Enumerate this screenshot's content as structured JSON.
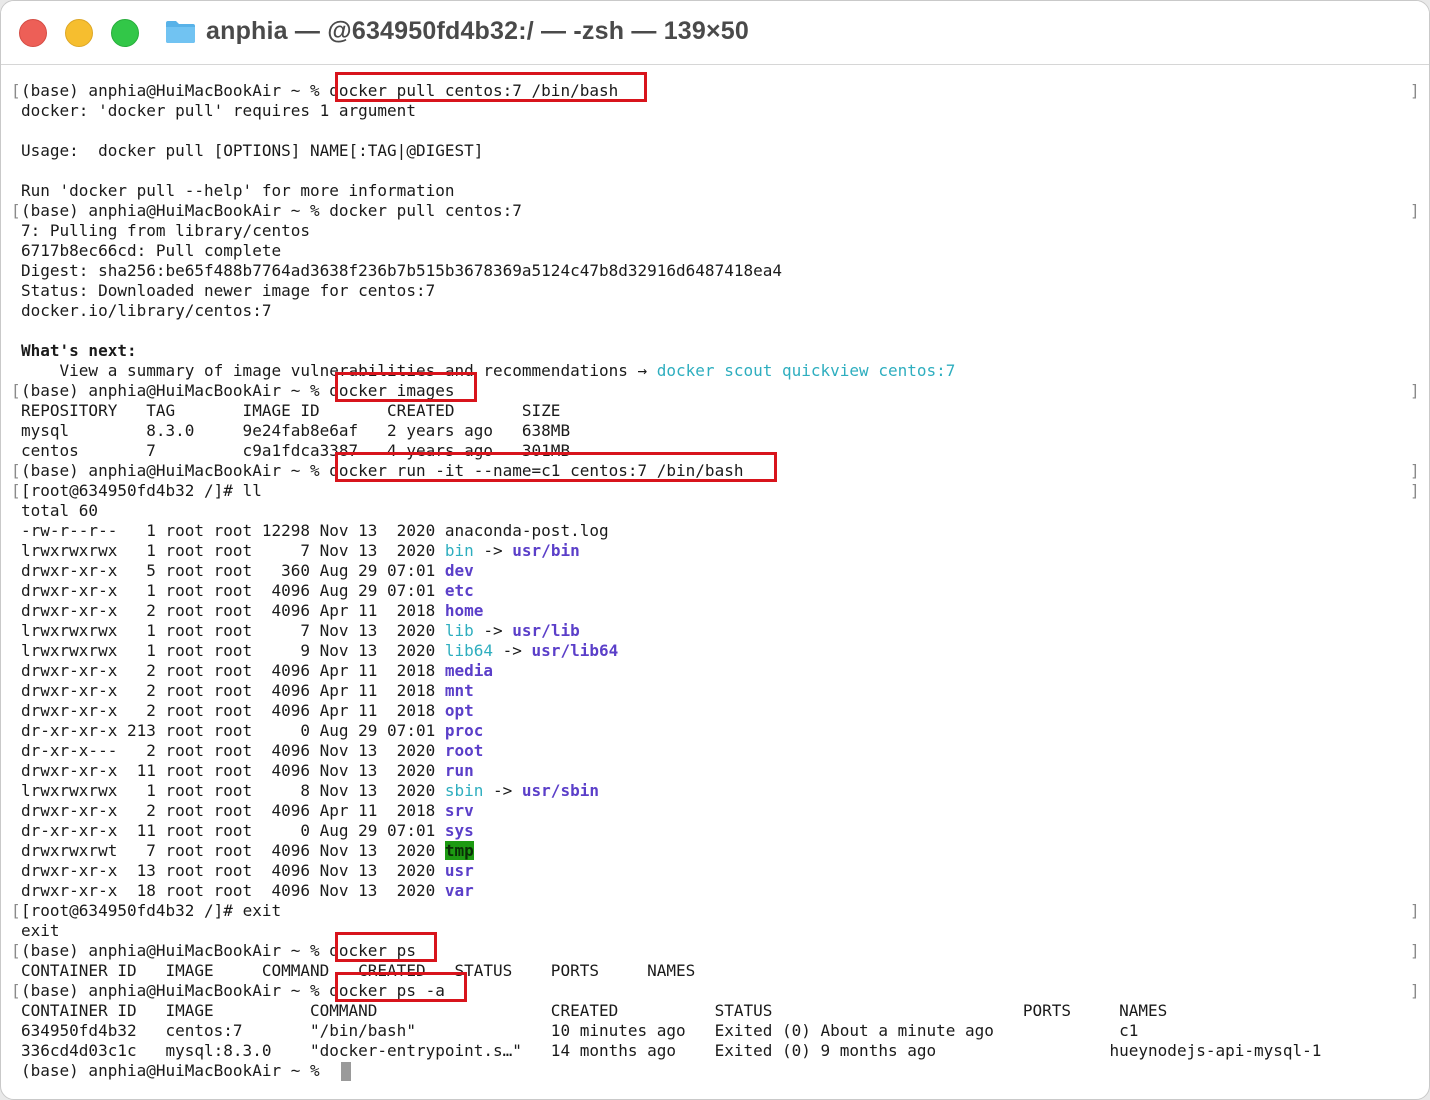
{
  "window": {
    "title": "anphia — @634950fd4b32:/ — -zsh — 139×50",
    "traffic_lights": {
      "close": "#ed5f57",
      "minimize": "#f6be2f",
      "maximize": "#32c748"
    },
    "folder_icon": "folder-icon"
  },
  "colors": {
    "highlight_box": "#d8141c",
    "link_cyan": "#2eaebf",
    "dir_purple": "#5b3fc9",
    "tmp_green": "#1d9a12"
  },
  "terminal": {
    "prompt_base": "(base) anphia@HuiMacBookAir ~ % ",
    "prompt_root": "[root@634950fd4b32 /]# ",
    "cmd_pull_bad": "docker pull centos:7 /bin/bash",
    "err_requires": "docker: 'docker pull' requires 1 argument",
    "usage": "Usage:  docker pull [OPTIONS] NAME[:TAG|@DIGEST]",
    "help_hint": "Run 'docker pull --help' for more information",
    "cmd_pull": "docker pull centos:7",
    "pull_lines": [
      "7: Pulling from library/centos",
      "6717b8ec66cd: Pull complete",
      "Digest: sha256:be65f488b7764ad3638f236b7b515b3678369a5124c47b8d32916d6487418ea4",
      "Status: Downloaded newer image for centos:7",
      "docker.io/library/centos:7"
    ],
    "whats_next": "What's next:",
    "scout_text": "    View a summary of image vulnerabilities and recommendations → ",
    "scout_cmd": "docker scout quickview centos:7",
    "cmd_images": "docker images",
    "images_table": [
      "REPOSITORY   TAG       IMAGE ID       CREATED       SIZE",
      "mysql        8.3.0     9e24fab8e6af   2 years ago   638MB",
      "centos       7         c9a1fdca3387   4 years ago   301MB"
    ],
    "cmd_run": "docker run -it --name=c1 centos:7 /bin/bash",
    "cmd_ll": "ll",
    "total": "total 60",
    "ls_rows": [
      {
        "meta": "-rw-r--r--   1 root root 12298 Nov 13  2020 ",
        "name": "anaconda-post.log",
        "style": "plain",
        "target": ""
      },
      {
        "meta": "lrwxrwxrwx   1 root root     7 Nov 13  2020 ",
        "name": "bin",
        "style": "link",
        "target": "usr/bin"
      },
      {
        "meta": "drwxr-xr-x   5 root root   360 Aug 29 07:01 ",
        "name": "dev",
        "style": "dir",
        "target": ""
      },
      {
        "meta": "drwxr-xr-x   1 root root  4096 Aug 29 07:01 ",
        "name": "etc",
        "style": "dir",
        "target": ""
      },
      {
        "meta": "drwxr-xr-x   2 root root  4096 Apr 11  2018 ",
        "name": "home",
        "style": "dir",
        "target": ""
      },
      {
        "meta": "lrwxrwxrwx   1 root root     7 Nov 13  2020 ",
        "name": "lib",
        "style": "link",
        "target": "usr/lib"
      },
      {
        "meta": "lrwxrwxrwx   1 root root     9 Nov 13  2020 ",
        "name": "lib64",
        "style": "link",
        "target": "usr/lib64"
      },
      {
        "meta": "drwxr-xr-x   2 root root  4096 Apr 11  2018 ",
        "name": "media",
        "style": "dir",
        "target": ""
      },
      {
        "meta": "drwxr-xr-x   2 root root  4096 Apr 11  2018 ",
        "name": "mnt",
        "style": "dir",
        "target": ""
      },
      {
        "meta": "drwxr-xr-x   2 root root  4096 Apr 11  2018 ",
        "name": "opt",
        "style": "dir",
        "target": ""
      },
      {
        "meta": "dr-xr-xr-x 213 root root     0 Aug 29 07:01 ",
        "name": "proc",
        "style": "dir",
        "target": ""
      },
      {
        "meta": "dr-xr-x---   2 root root  4096 Nov 13  2020 ",
        "name": "root",
        "style": "dir",
        "target": ""
      },
      {
        "meta": "drwxr-xr-x  11 root root  4096 Nov 13  2020 ",
        "name": "run",
        "style": "dir",
        "target": ""
      },
      {
        "meta": "lrwxrwxrwx   1 root root     8 Nov 13  2020 ",
        "name": "sbin",
        "style": "link",
        "target": "usr/sbin"
      },
      {
        "meta": "drwxr-xr-x   2 root root  4096 Apr 11  2018 ",
        "name": "srv",
        "style": "dir",
        "target": ""
      },
      {
        "meta": "dr-xr-xr-x  11 root root     0 Aug 29 07:01 ",
        "name": "sys",
        "style": "dir",
        "target": ""
      },
      {
        "meta": "drwxrwxrwt   7 root root  4096 Nov 13  2020 ",
        "name": "tmp",
        "style": "tmp",
        "target": ""
      },
      {
        "meta": "drwxr-xr-x  13 root root  4096 Nov 13  2020 ",
        "name": "usr",
        "style": "dir",
        "target": ""
      },
      {
        "meta": "drwxr-xr-x  18 root root  4096 Nov 13  2020 ",
        "name": "var",
        "style": "dir",
        "target": ""
      }
    ],
    "link_arrow": " -> ",
    "cmd_exit": "exit",
    "exit_echo": "exit",
    "cmd_ps": "docker ps",
    "ps_header": "CONTAINER ID   IMAGE     COMMAND   CREATED   STATUS    PORTS     NAMES",
    "cmd_ps_a": "docker ps -a",
    "ps_a_table": [
      "CONTAINER ID   IMAGE          COMMAND                  CREATED          STATUS                          PORTS     NAMES",
      "634950fd4b32   centos:7       \"/bin/bash\"              10 minutes ago   Exited (0) About a minute ago             c1",
      "336cd4d03c1c   mysql:8.3.0    \"docker-entrypoint.s…\"   14 months ago    Exited (0) 9 months ago                  hueynodejs-api-mysql-1"
    ]
  }
}
